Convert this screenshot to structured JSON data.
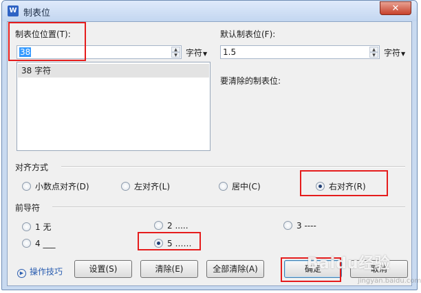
{
  "window": {
    "title": "制表位",
    "app_icon_label": "W",
    "close_glyph": "✕"
  },
  "tab_position": {
    "label": "制表位位置(T):",
    "value": "38",
    "unit": "字符",
    "list": [
      "38 字符"
    ]
  },
  "default_tab": {
    "label": "默认制表位(F):",
    "value": "1.5",
    "unit": "字符"
  },
  "clear_label": "要清除的制表位:",
  "alignment": {
    "title": "对齐方式",
    "options": [
      "小数点对齐(D)",
      "左对齐(L)",
      "居中(C)",
      "右对齐(R)"
    ],
    "selected": "右对齐(R)"
  },
  "leader": {
    "title": "前导符",
    "options": [
      "1 无",
      "2 .....",
      "3 ----",
      "4 ___",
      "5 ……"
    ],
    "selected": "5 ……"
  },
  "tips_label": "操作技巧",
  "buttons": {
    "set": "设置(S)",
    "clear": "清除(E)",
    "clear_all": "全部清除(A)",
    "ok": "确定",
    "cancel": "取消"
  },
  "watermark": {
    "text": "Baidu经验",
    "sub": "jingyan.baidu.com"
  },
  "colors": {
    "highlight": "#e51b1b",
    "selection": "#3399ff",
    "link": "#2a5db0"
  }
}
